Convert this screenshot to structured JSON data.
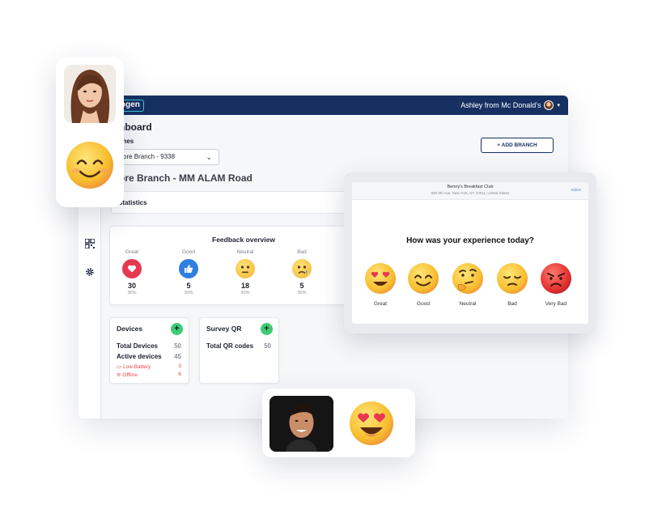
{
  "topbar": {
    "logo": "ogen",
    "account": "Ashley from Mc Donald's"
  },
  "page": {
    "title": "hboard",
    "branches_label": "ches",
    "branch_select_value": "ore Branch - 9338",
    "branch_heading": "ore Branch - MM ALAM Road",
    "add_branch": "+ ADD BRANCH",
    "statistics_label": "Statistics"
  },
  "feedback": {
    "title": "Feedback overview",
    "items": [
      {
        "label": "Great",
        "count": "30",
        "pct": "30%",
        "icon": "heart-icon",
        "color": "#e8384f"
      },
      {
        "label": "Good",
        "count": "5",
        "pct": "30%",
        "icon": "thumbs-up-icon",
        "color": "#2f7fe0"
      },
      {
        "label": "Neutral",
        "count": "18",
        "pct": "30%",
        "icon": "neutral-face-icon",
        "color": "#f5c03a"
      },
      {
        "label": "Bad",
        "count": "5",
        "pct": "30%",
        "icon": "sad-face-icon",
        "color": "#f5c03a"
      }
    ]
  },
  "devices": {
    "title": "Devices",
    "total_label": "Total Devices",
    "total_value": "50",
    "active_label": "Active devices",
    "active_value": "45",
    "low_battery_label": "Low Battery",
    "low_battery_value": "3",
    "offline_label": "Offline",
    "offline_value": "6"
  },
  "survey_qr": {
    "title": "Survey QR",
    "total_label": "Total QR codes",
    "total_value": "50"
  },
  "tablet": {
    "business": "Benny's Breakfast Club",
    "address": "690 6th Ave, New York, NY 10011, United States",
    "edit": "Admin",
    "question": "How was your experience today?",
    "choices": [
      "Great",
      "Good",
      "Neutral",
      "Bad",
      "Very Bad"
    ]
  },
  "colors": {
    "navy": "#163062",
    "green": "#3fca73",
    "red": "#e5484d"
  }
}
